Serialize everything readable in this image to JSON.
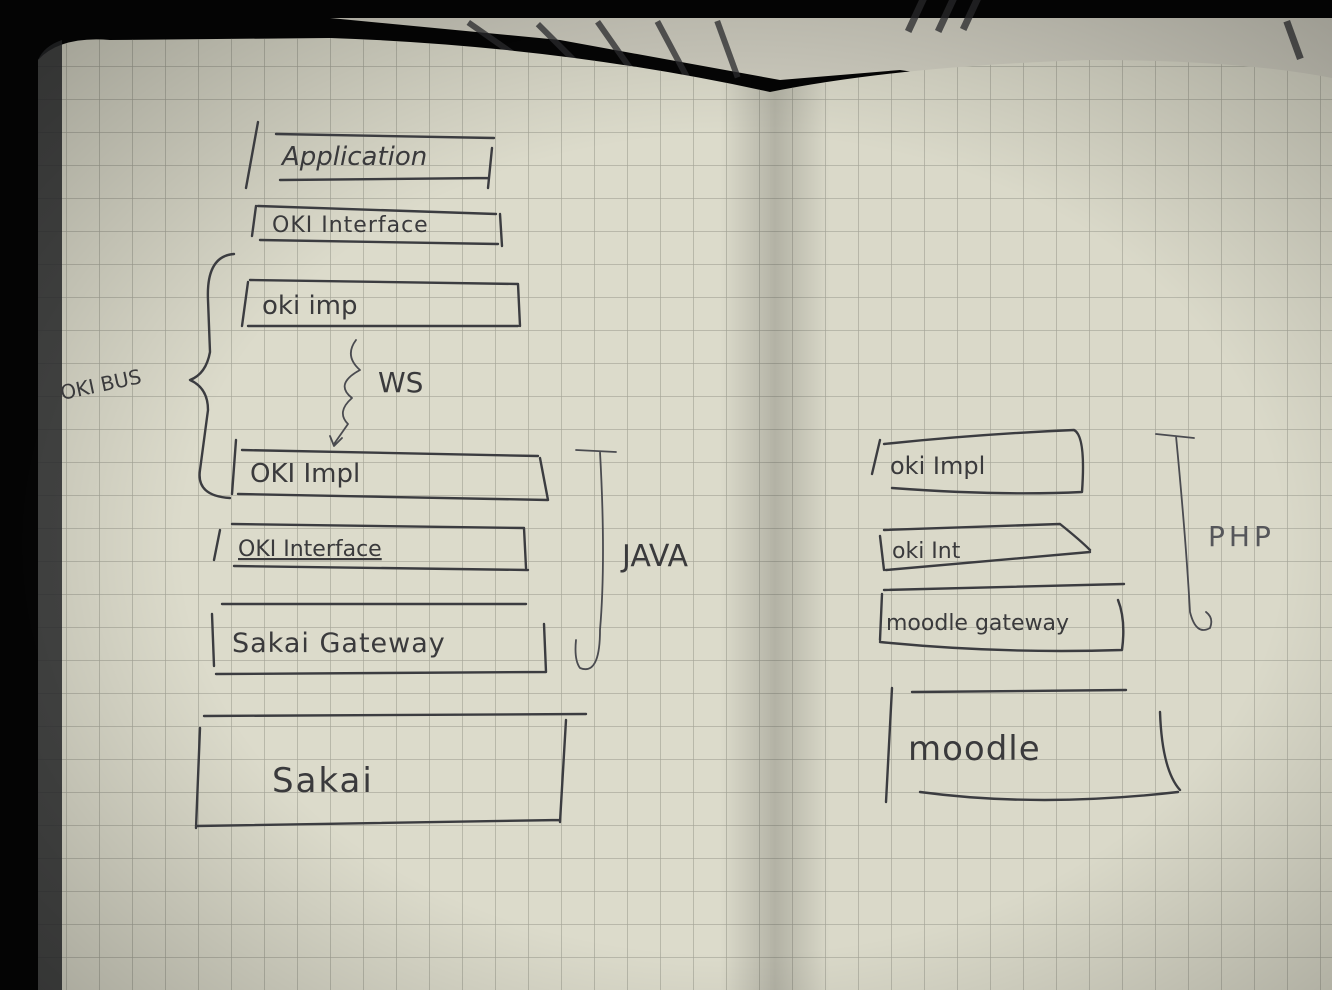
{
  "left_page": {
    "layers": [
      {
        "id": "application",
        "label": "Application"
      },
      {
        "id": "oki-interface-top",
        "label": "OKI Interface"
      },
      {
        "id": "oki-impl-top",
        "label": "oki imp"
      },
      {
        "id": "oki-impl-bottom",
        "label": "OKI Impl"
      },
      {
        "id": "oki-interface-bottom",
        "label": "OKI Interface"
      },
      {
        "id": "sakai-gateway",
        "label": "Sakai Gateway"
      },
      {
        "id": "sakai",
        "label": "Sakai"
      }
    ],
    "brace_label": "OKI BUS",
    "connector_label": "WS",
    "bracket_label": "JAVA"
  },
  "right_page": {
    "layers": [
      {
        "id": "oki-impl",
        "label": "oki Impl"
      },
      {
        "id": "oki-int",
        "label": "oki Int"
      },
      {
        "id": "moodle-gateway",
        "label": "moodle gateway"
      },
      {
        "id": "moodle",
        "label": "moodle"
      }
    ],
    "bracket_label": "PHP"
  },
  "colors": {
    "paper": "#dcdbcb",
    "paper_shadow": "#b9b8a8",
    "grid": "#a9a99b",
    "ink": "#3b3c40",
    "background": "#050505"
  }
}
